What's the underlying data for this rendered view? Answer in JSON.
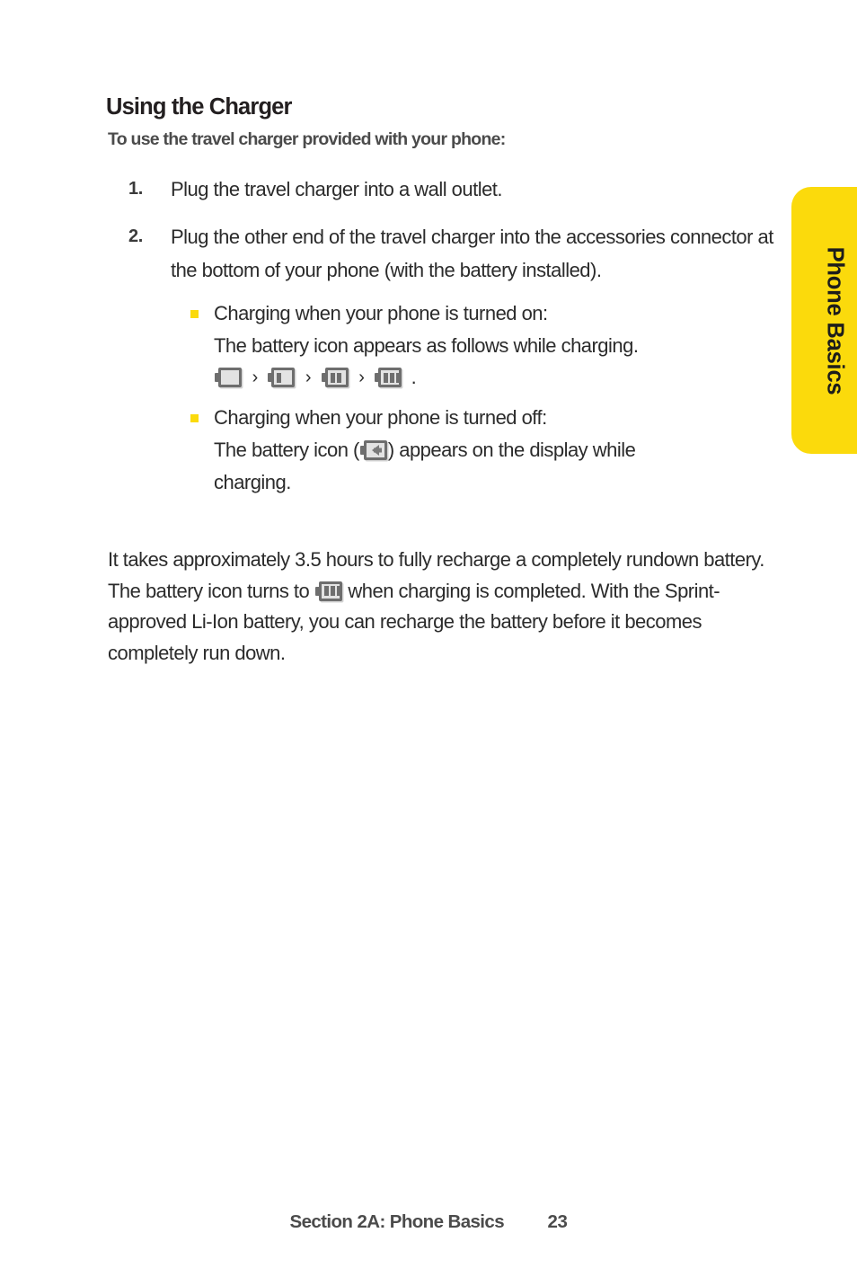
{
  "section_tab": {
    "label": "Phone Basics",
    "color": "#FBDA0C"
  },
  "heading": "Using the Charger",
  "intro": "To use the travel charger provided with your phone:",
  "steps": [
    {
      "marker": "1.",
      "text": "Plug the travel charger into a wall outlet."
    },
    {
      "marker": "2.",
      "text": "Plug the other end of the travel charger into the accessories connector at the bottom of your phone (with the battery installed)."
    }
  ],
  "substeps": [
    {
      "line1": "Charging when your phone is turned on:",
      "line2": "The battery icon appears as follows while charging.",
      "icons": [
        {
          "name": "battery-empty-icon",
          "bars": 0
        },
        {
          "name": "battery-one-bar-icon",
          "bars": 1
        },
        {
          "name": "battery-two-bars-icon",
          "bars": 2
        },
        {
          "name": "battery-three-bars-icon",
          "bars": 3
        }
      ],
      "separator": "›",
      "trailing": "."
    },
    {
      "line1": "Charging when your phone is turned off:",
      "line2_before": "The battery icon  (",
      "icon": {
        "name": "battery-charging-arrow-icon"
      },
      "line2_after": ") appears on the display while",
      "line3": "charging."
    }
  ],
  "closing": {
    "before_icon": "It takes approximately 3.5 hours to fully recharge a completely rundown battery. The battery icon turns to ",
    "icon": {
      "name": "battery-full-icon",
      "bars": 3
    },
    "after_icon": " when charging is completed. With the Sprint-approved Li-Ion battery, you can recharge the battery before it becomes completely run down."
  },
  "footer": {
    "section": "Section 2A: Phone Basics",
    "page": "23"
  }
}
